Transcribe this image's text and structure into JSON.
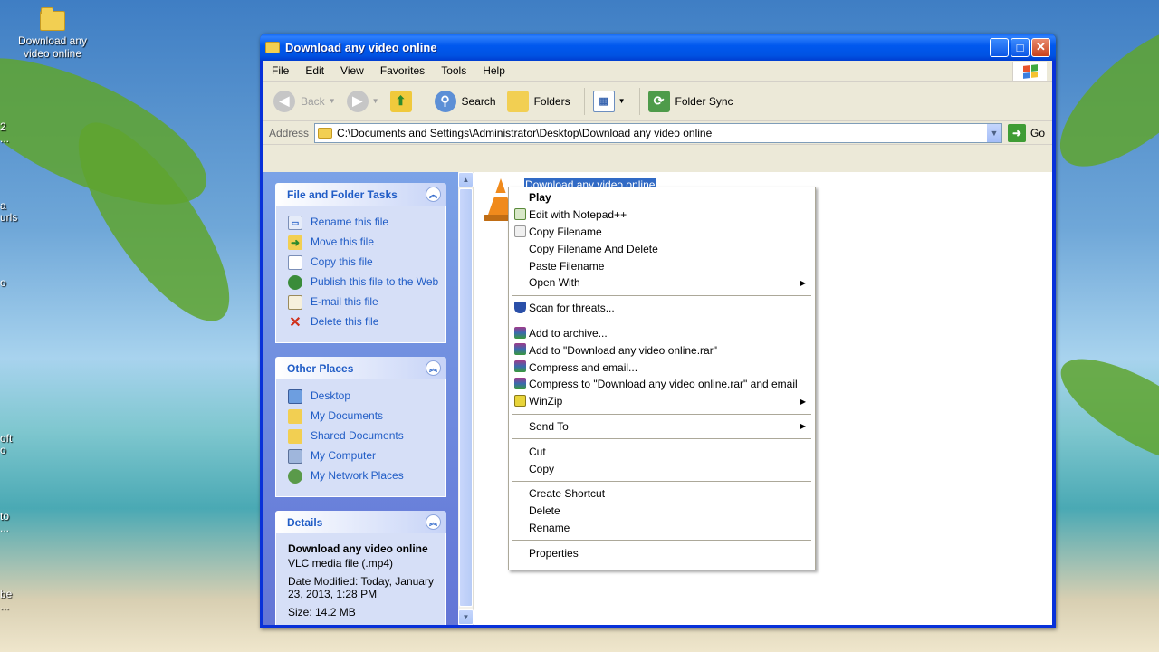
{
  "desktop": {
    "icon_label": "Download any video online",
    "edge_fragments": [
      "2",
      "...",
      "a",
      "urls",
      "o",
      "oft",
      "o",
      "to",
      "...",
      "be",
      "..."
    ]
  },
  "window": {
    "title": "Download any video online",
    "controls": {
      "minimize": "_",
      "maximize": "□",
      "close": "✕"
    }
  },
  "menubar": {
    "items": [
      "File",
      "Edit",
      "View",
      "Favorites",
      "Tools",
      "Help"
    ]
  },
  "toolbar": {
    "back": "Back",
    "search": "Search",
    "folders": "Folders",
    "folder_sync": "Folder Sync"
  },
  "address": {
    "label": "Address",
    "value": "C:\\Documents and Settings\\Administrator\\Desktop\\Download any video online",
    "go": "Go"
  },
  "tasks": {
    "file_folder": {
      "title": "File and Folder Tasks",
      "items": [
        "Rename this file",
        "Move this file",
        "Copy this file",
        "Publish this file to the Web",
        "E-mail this file",
        "Delete this file"
      ]
    },
    "other_places": {
      "title": "Other Places",
      "items": [
        "Desktop",
        "My Documents",
        "Shared Documents",
        "My Computer",
        "My Network Places"
      ]
    },
    "details": {
      "title": "Details",
      "name": "Download any video online",
      "type": "VLC media file (.mp4)",
      "modified": "Date Modified: Today, January 23, 2013, 1:28 PM",
      "size": "Size: 14.2 MB"
    }
  },
  "file": {
    "name": "Download any video online",
    "type": "VLC media file (.mp4)"
  },
  "context_menu": {
    "groups": [
      [
        "Play",
        "Edit with Notepad++",
        "Copy Filename",
        "Copy Filename And Delete",
        "Paste Filename",
        "Open With"
      ],
      [
        "Scan for threats..."
      ],
      [
        "Add to archive...",
        "Add to \"Download any video online.rar\"",
        "Compress and email...",
        "Compress to \"Download any video online.rar\" and email",
        "WinZip"
      ],
      [
        "Send To"
      ],
      [
        "Cut",
        "Copy"
      ],
      [
        "Create Shortcut",
        "Delete",
        "Rename"
      ],
      [
        "Properties"
      ]
    ]
  },
  "colors": {
    "title_blue": "#0058ee",
    "taskpane_link": "#215dc6",
    "selection": "#316ac5"
  }
}
